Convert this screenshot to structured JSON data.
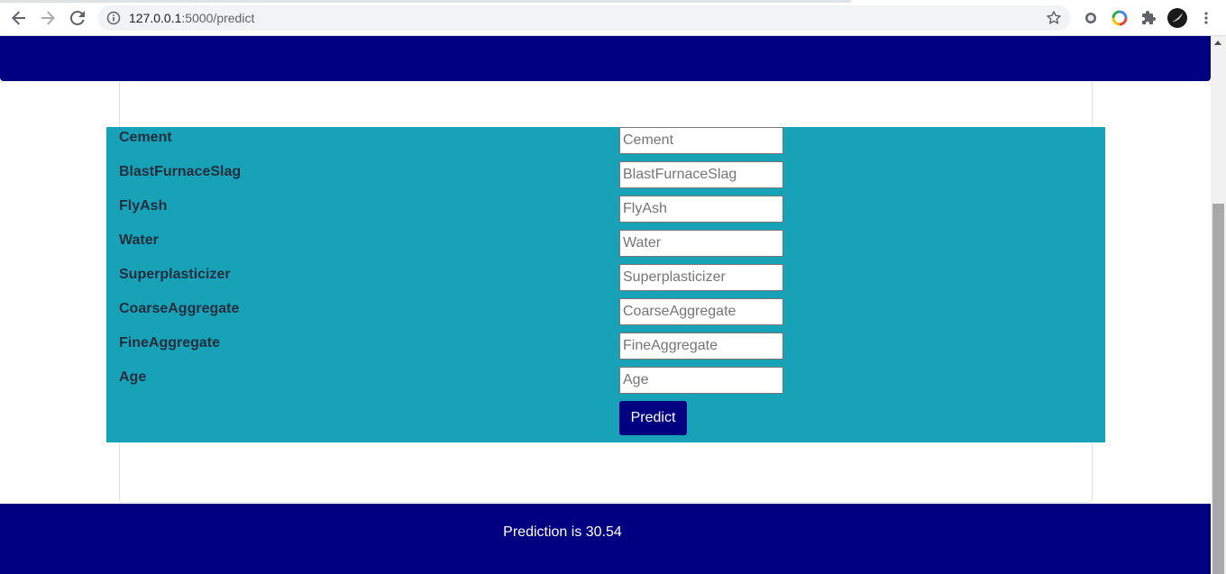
{
  "browser": {
    "url_host": "127.0.0.1",
    "url_path": ":5000/predict"
  },
  "form": {
    "fields": [
      {
        "label": "Cement",
        "placeholder": "Cement"
      },
      {
        "label": "BlastFurnaceSlag",
        "placeholder": "BlastFurnaceSlag"
      },
      {
        "label": "FlyAsh",
        "placeholder": "FlyAsh"
      },
      {
        "label": "Water",
        "placeholder": "Water"
      },
      {
        "label": "Superplasticizer",
        "placeholder": "Superplasticizer"
      },
      {
        "label": "CoarseAggregate",
        "placeholder": "CoarseAggregate"
      },
      {
        "label": "FineAggregate",
        "placeholder": "FineAggregate"
      },
      {
        "label": "Age",
        "placeholder": "Age"
      }
    ],
    "submit_label": "Predict"
  },
  "result": {
    "text": "Prediction is 30.54"
  },
  "colors": {
    "header": "#000080",
    "form_band": "#17a2b8",
    "button": "#000080"
  }
}
